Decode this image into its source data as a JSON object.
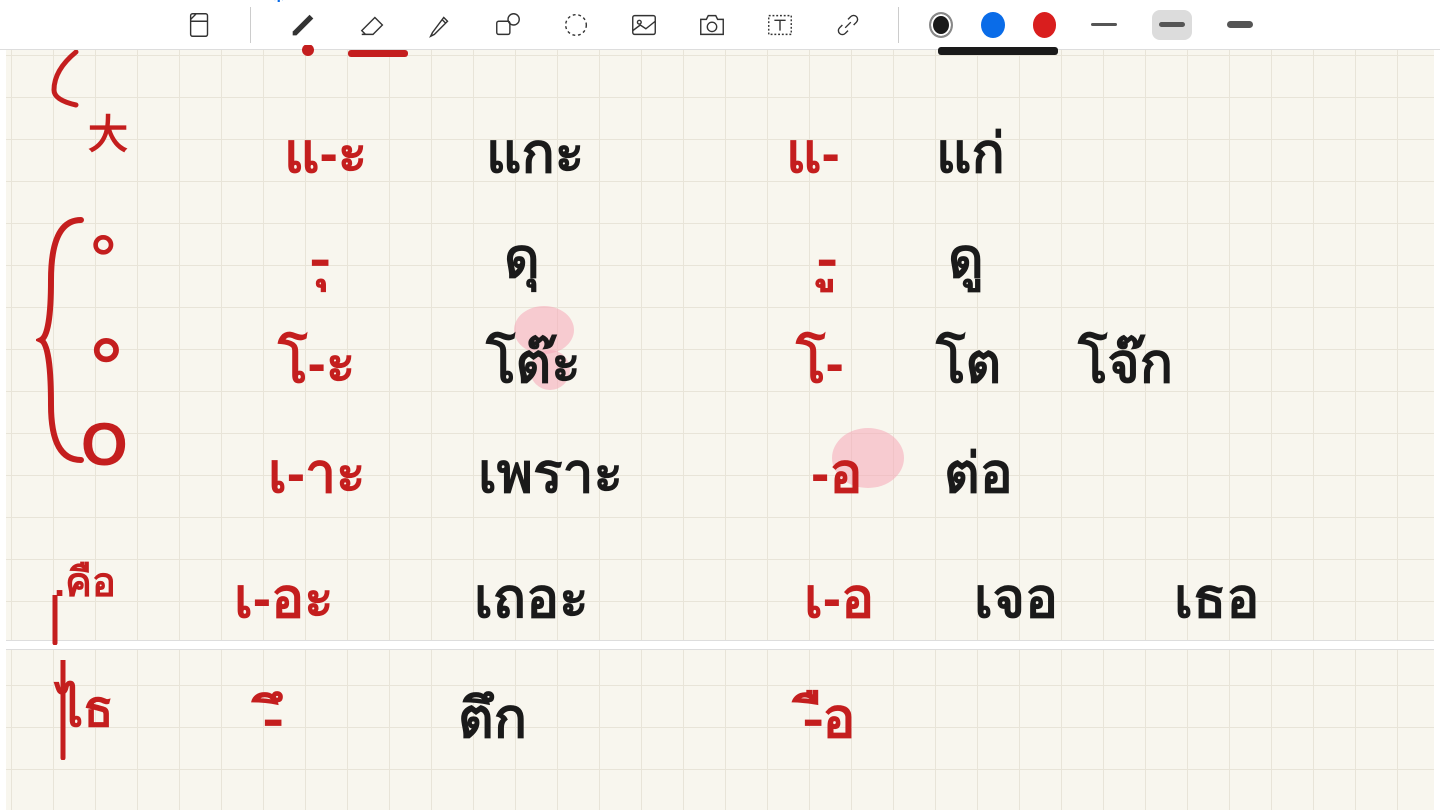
{
  "toolbar": {
    "colors": {
      "black": "#1a1a1a",
      "blue": "#0a6ce8",
      "red": "#d91e1e"
    }
  },
  "canvas": {
    "margin_left": {
      "m1": "大",
      "m2": "๐",
      "m3": "๐",
      "m4": "O",
      "m5": ".คือ",
      "m6": "ไธ"
    },
    "rows": [
      {
        "short_vowel": "แ-ะ",
        "short_ex": "แกะ",
        "long_vowel": "แ-",
        "long_ex1": "แก่",
        "long_ex2": ""
      },
      {
        "short_vowel": "-ุ",
        "short_ex": "ดุ",
        "long_vowel": "-ู",
        "long_ex1": "ดู",
        "long_ex2": ""
      },
      {
        "short_vowel": "โ-ะ",
        "short_ex": "โต๊ะ",
        "long_vowel": "โ-",
        "long_ex1": "โต",
        "long_ex2": "โจ๊ก"
      },
      {
        "short_vowel": "เ-าะ",
        "short_ex": "เพราะ",
        "long_vowel": "-อ",
        "long_ex1": "ต่อ",
        "long_ex2": ""
      },
      {
        "short_vowel": "เ-อะ",
        "short_ex": "เถอะ",
        "long_vowel": "เ-อ",
        "long_ex1": "เจอ",
        "long_ex2": "เธอ"
      },
      {
        "short_vowel": "-ึ",
        "short_ex": "ตึก",
        "long_vowel": "-ือ",
        "long_ex1": "",
        "long_ex2": ""
      }
    ]
  }
}
